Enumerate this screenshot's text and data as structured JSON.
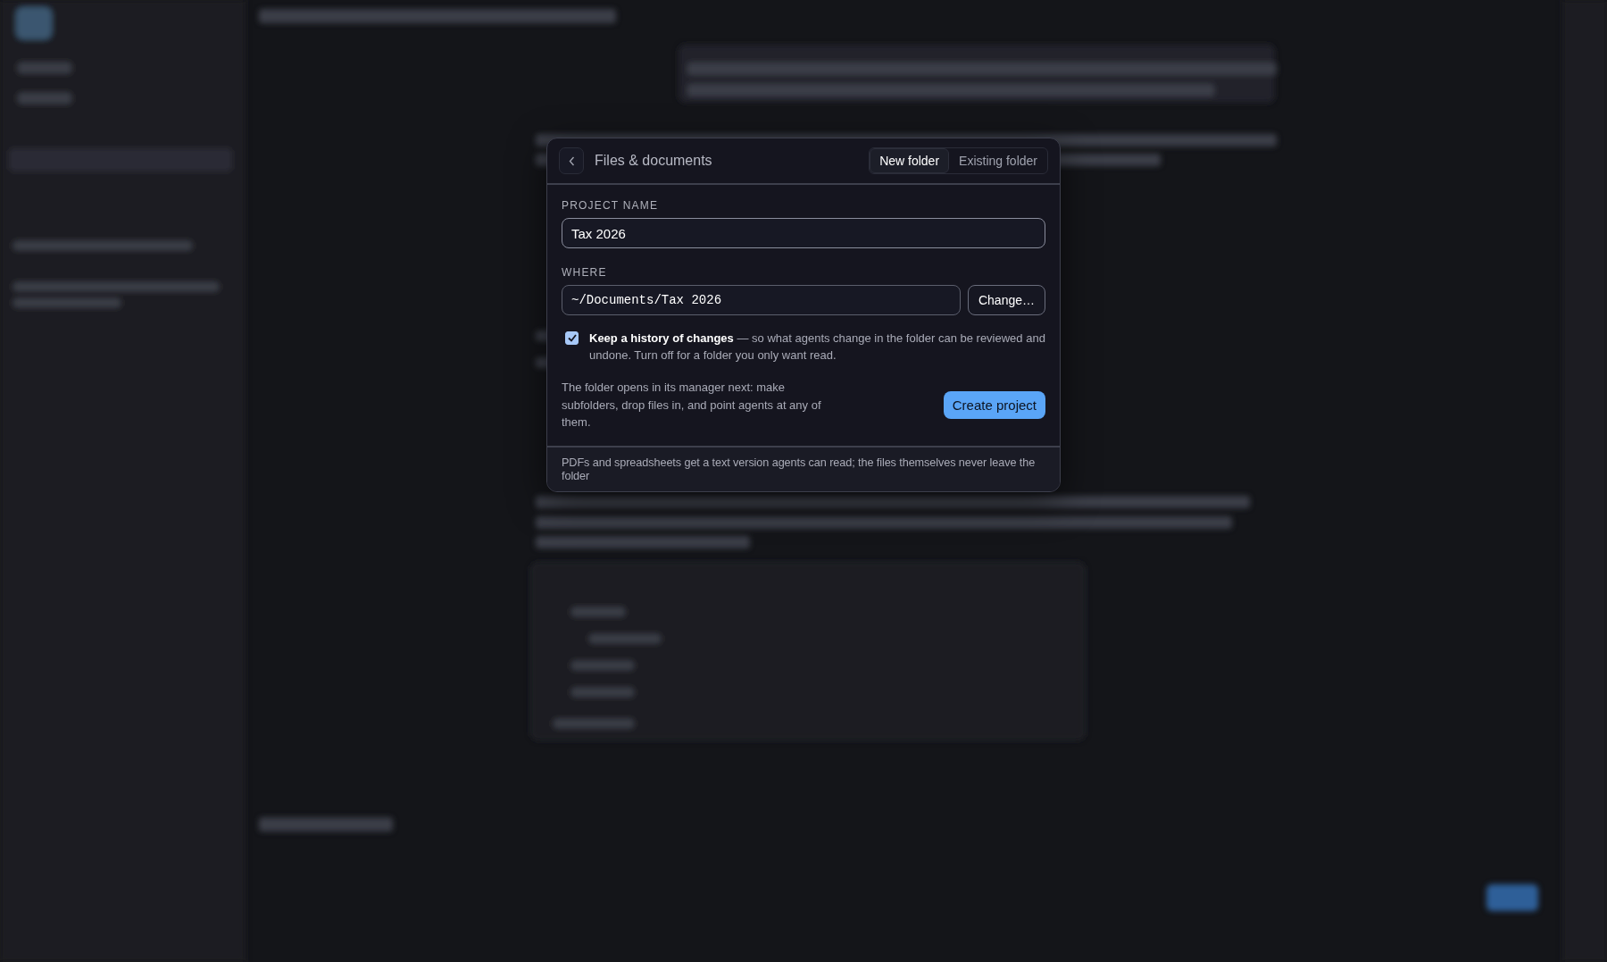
{
  "dialog": {
    "title": "Files & documents",
    "tabs": [
      {
        "label": "New folder",
        "selected": true
      },
      {
        "label": "Existing folder",
        "selected": false
      }
    ],
    "project_name": {
      "label": "PROJECT NAME",
      "value": "Tax 2026"
    },
    "where": {
      "label": "WHERE",
      "value": "~/Documents/Tax 2026",
      "button": "Change…"
    },
    "history": {
      "checked": true,
      "text": "**Keep a history of changes** — so what agents change in the folder can be reviewed and undone. Turn off for a folder you only want read."
    },
    "info": "The folder opens in its manager next: make subfolders, drop files in, and point agents at any of them.",
    "primary_button": "Create project",
    "footer": "PDFs and spreadsheets get a text version agents can read; the files themselves never leave the folder"
  }
}
